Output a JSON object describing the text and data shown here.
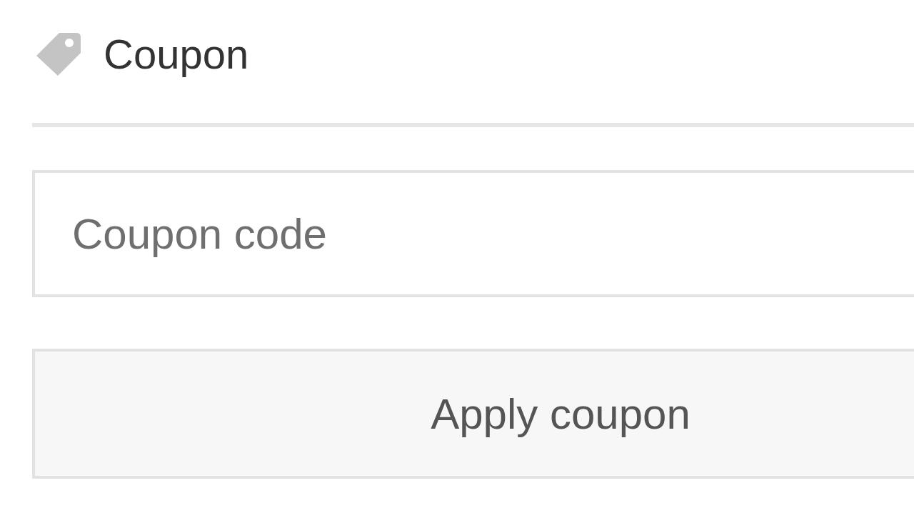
{
  "section": {
    "title": "Coupon"
  },
  "coupon_field": {
    "placeholder": "Coupon code"
  },
  "apply_button": {
    "label": "Apply coupon"
  }
}
